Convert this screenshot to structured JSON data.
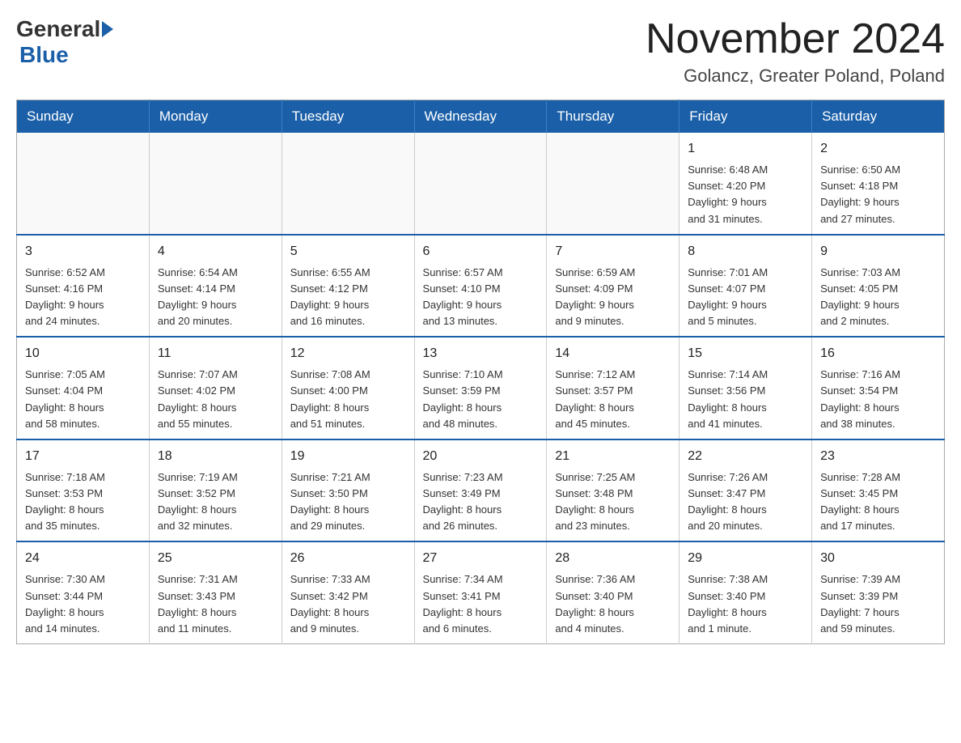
{
  "logo": {
    "general": "General",
    "blue": "Blue"
  },
  "title": "November 2024",
  "location": "Golancz, Greater Poland, Poland",
  "days_of_week": [
    "Sunday",
    "Monday",
    "Tuesday",
    "Wednesday",
    "Thursday",
    "Friday",
    "Saturday"
  ],
  "weeks": [
    [
      {
        "day": "",
        "info": ""
      },
      {
        "day": "",
        "info": ""
      },
      {
        "day": "",
        "info": ""
      },
      {
        "day": "",
        "info": ""
      },
      {
        "day": "",
        "info": ""
      },
      {
        "day": "1",
        "info": "Sunrise: 6:48 AM\nSunset: 4:20 PM\nDaylight: 9 hours\nand 31 minutes."
      },
      {
        "day": "2",
        "info": "Sunrise: 6:50 AM\nSunset: 4:18 PM\nDaylight: 9 hours\nand 27 minutes."
      }
    ],
    [
      {
        "day": "3",
        "info": "Sunrise: 6:52 AM\nSunset: 4:16 PM\nDaylight: 9 hours\nand 24 minutes."
      },
      {
        "day": "4",
        "info": "Sunrise: 6:54 AM\nSunset: 4:14 PM\nDaylight: 9 hours\nand 20 minutes."
      },
      {
        "day": "5",
        "info": "Sunrise: 6:55 AM\nSunset: 4:12 PM\nDaylight: 9 hours\nand 16 minutes."
      },
      {
        "day": "6",
        "info": "Sunrise: 6:57 AM\nSunset: 4:10 PM\nDaylight: 9 hours\nand 13 minutes."
      },
      {
        "day": "7",
        "info": "Sunrise: 6:59 AM\nSunset: 4:09 PM\nDaylight: 9 hours\nand 9 minutes."
      },
      {
        "day": "8",
        "info": "Sunrise: 7:01 AM\nSunset: 4:07 PM\nDaylight: 9 hours\nand 5 minutes."
      },
      {
        "day": "9",
        "info": "Sunrise: 7:03 AM\nSunset: 4:05 PM\nDaylight: 9 hours\nand 2 minutes."
      }
    ],
    [
      {
        "day": "10",
        "info": "Sunrise: 7:05 AM\nSunset: 4:04 PM\nDaylight: 8 hours\nand 58 minutes."
      },
      {
        "day": "11",
        "info": "Sunrise: 7:07 AM\nSunset: 4:02 PM\nDaylight: 8 hours\nand 55 minutes."
      },
      {
        "day": "12",
        "info": "Sunrise: 7:08 AM\nSunset: 4:00 PM\nDaylight: 8 hours\nand 51 minutes."
      },
      {
        "day": "13",
        "info": "Sunrise: 7:10 AM\nSunset: 3:59 PM\nDaylight: 8 hours\nand 48 minutes."
      },
      {
        "day": "14",
        "info": "Sunrise: 7:12 AM\nSunset: 3:57 PM\nDaylight: 8 hours\nand 45 minutes."
      },
      {
        "day": "15",
        "info": "Sunrise: 7:14 AM\nSunset: 3:56 PM\nDaylight: 8 hours\nand 41 minutes."
      },
      {
        "day": "16",
        "info": "Sunrise: 7:16 AM\nSunset: 3:54 PM\nDaylight: 8 hours\nand 38 minutes."
      }
    ],
    [
      {
        "day": "17",
        "info": "Sunrise: 7:18 AM\nSunset: 3:53 PM\nDaylight: 8 hours\nand 35 minutes."
      },
      {
        "day": "18",
        "info": "Sunrise: 7:19 AM\nSunset: 3:52 PM\nDaylight: 8 hours\nand 32 minutes."
      },
      {
        "day": "19",
        "info": "Sunrise: 7:21 AM\nSunset: 3:50 PM\nDaylight: 8 hours\nand 29 minutes."
      },
      {
        "day": "20",
        "info": "Sunrise: 7:23 AM\nSunset: 3:49 PM\nDaylight: 8 hours\nand 26 minutes."
      },
      {
        "day": "21",
        "info": "Sunrise: 7:25 AM\nSunset: 3:48 PM\nDaylight: 8 hours\nand 23 minutes."
      },
      {
        "day": "22",
        "info": "Sunrise: 7:26 AM\nSunset: 3:47 PM\nDaylight: 8 hours\nand 20 minutes."
      },
      {
        "day": "23",
        "info": "Sunrise: 7:28 AM\nSunset: 3:45 PM\nDaylight: 8 hours\nand 17 minutes."
      }
    ],
    [
      {
        "day": "24",
        "info": "Sunrise: 7:30 AM\nSunset: 3:44 PM\nDaylight: 8 hours\nand 14 minutes."
      },
      {
        "day": "25",
        "info": "Sunrise: 7:31 AM\nSunset: 3:43 PM\nDaylight: 8 hours\nand 11 minutes."
      },
      {
        "day": "26",
        "info": "Sunrise: 7:33 AM\nSunset: 3:42 PM\nDaylight: 8 hours\nand 9 minutes."
      },
      {
        "day": "27",
        "info": "Sunrise: 7:34 AM\nSunset: 3:41 PM\nDaylight: 8 hours\nand 6 minutes."
      },
      {
        "day": "28",
        "info": "Sunrise: 7:36 AM\nSunset: 3:40 PM\nDaylight: 8 hours\nand 4 minutes."
      },
      {
        "day": "29",
        "info": "Sunrise: 7:38 AM\nSunset: 3:40 PM\nDaylight: 8 hours\nand 1 minute."
      },
      {
        "day": "30",
        "info": "Sunrise: 7:39 AM\nSunset: 3:39 PM\nDaylight: 7 hours\nand 59 minutes."
      }
    ]
  ]
}
